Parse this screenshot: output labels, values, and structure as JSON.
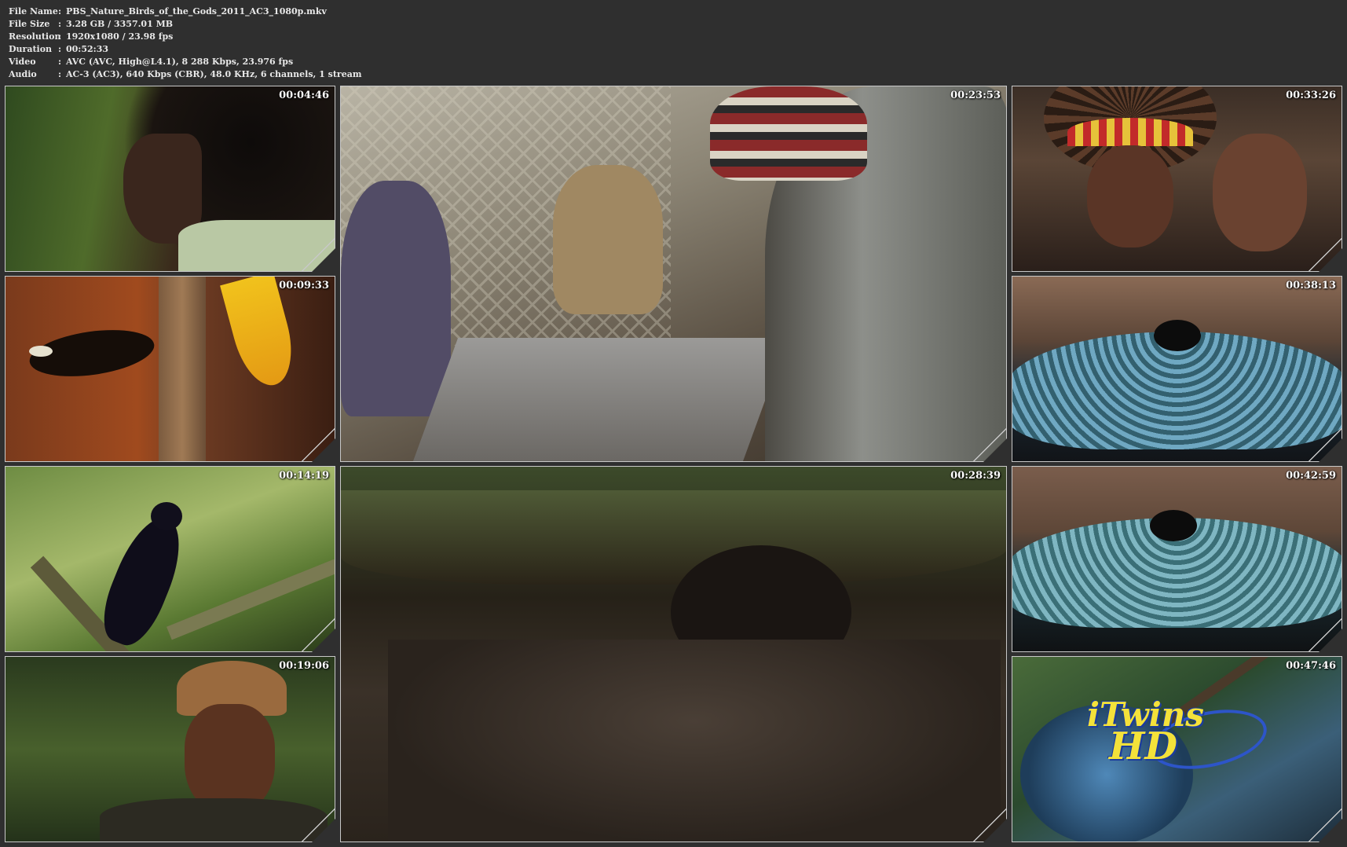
{
  "media_info": [
    {
      "label": "File Name",
      "value": "PBS_Nature_Birds_of_the_Gods_2011_AC3_1080p.mkv"
    },
    {
      "label": "File Size",
      "value": "3.28 GB  / 3357.01 MB"
    },
    {
      "label": "Resolution",
      "value": "1920x1080 / 23.98 fps"
    },
    {
      "label": "Duration",
      "value": "00:52:33"
    },
    {
      "label": "Video",
      "value": "AVC (AVC, High@L4.1), 8 288 Kbps, 23.976 fps"
    },
    {
      "label": "Audio",
      "value": "AC-3 (AC3), 640 Kbps (CBR), 48.0 KHz, 6 channels, 1 stream"
    }
  ],
  "separator": ":",
  "thumbnails": [
    {
      "timestamp": "00:04:46",
      "scene_icon": "person-profile-icon"
    },
    {
      "timestamp": "00:09:33",
      "scene_icon": "bird-of-paradise-icon"
    },
    {
      "timestamp": "00:14:19",
      "scene_icon": "bird-on-branch-icon"
    },
    {
      "timestamp": "00:19:06",
      "scene_icon": "man-with-cap-icon"
    },
    {
      "timestamp": "00:23:53",
      "scene_icon": "market-feathers-icon"
    },
    {
      "timestamp": "00:28:39",
      "scene_icon": "forest-floor-icon"
    },
    {
      "timestamp": "00:33:26",
      "scene_icon": "headdress-icon"
    },
    {
      "timestamp": "00:38:13",
      "scene_icon": "iridescent-feathers-icon"
    },
    {
      "timestamp": "00:42:59",
      "scene_icon": "iridescent-feathers-icon"
    },
    {
      "timestamp": "00:47:46",
      "scene_icon": "bird-on-branch-icon"
    }
  ],
  "watermark": {
    "line1": "iTwins",
    "line2": "HD"
  },
  "colors": {
    "background": "#2f2f2f",
    "text": "#e8e8e8",
    "border": "#c8c8c8",
    "logo": "#f4e23a"
  }
}
